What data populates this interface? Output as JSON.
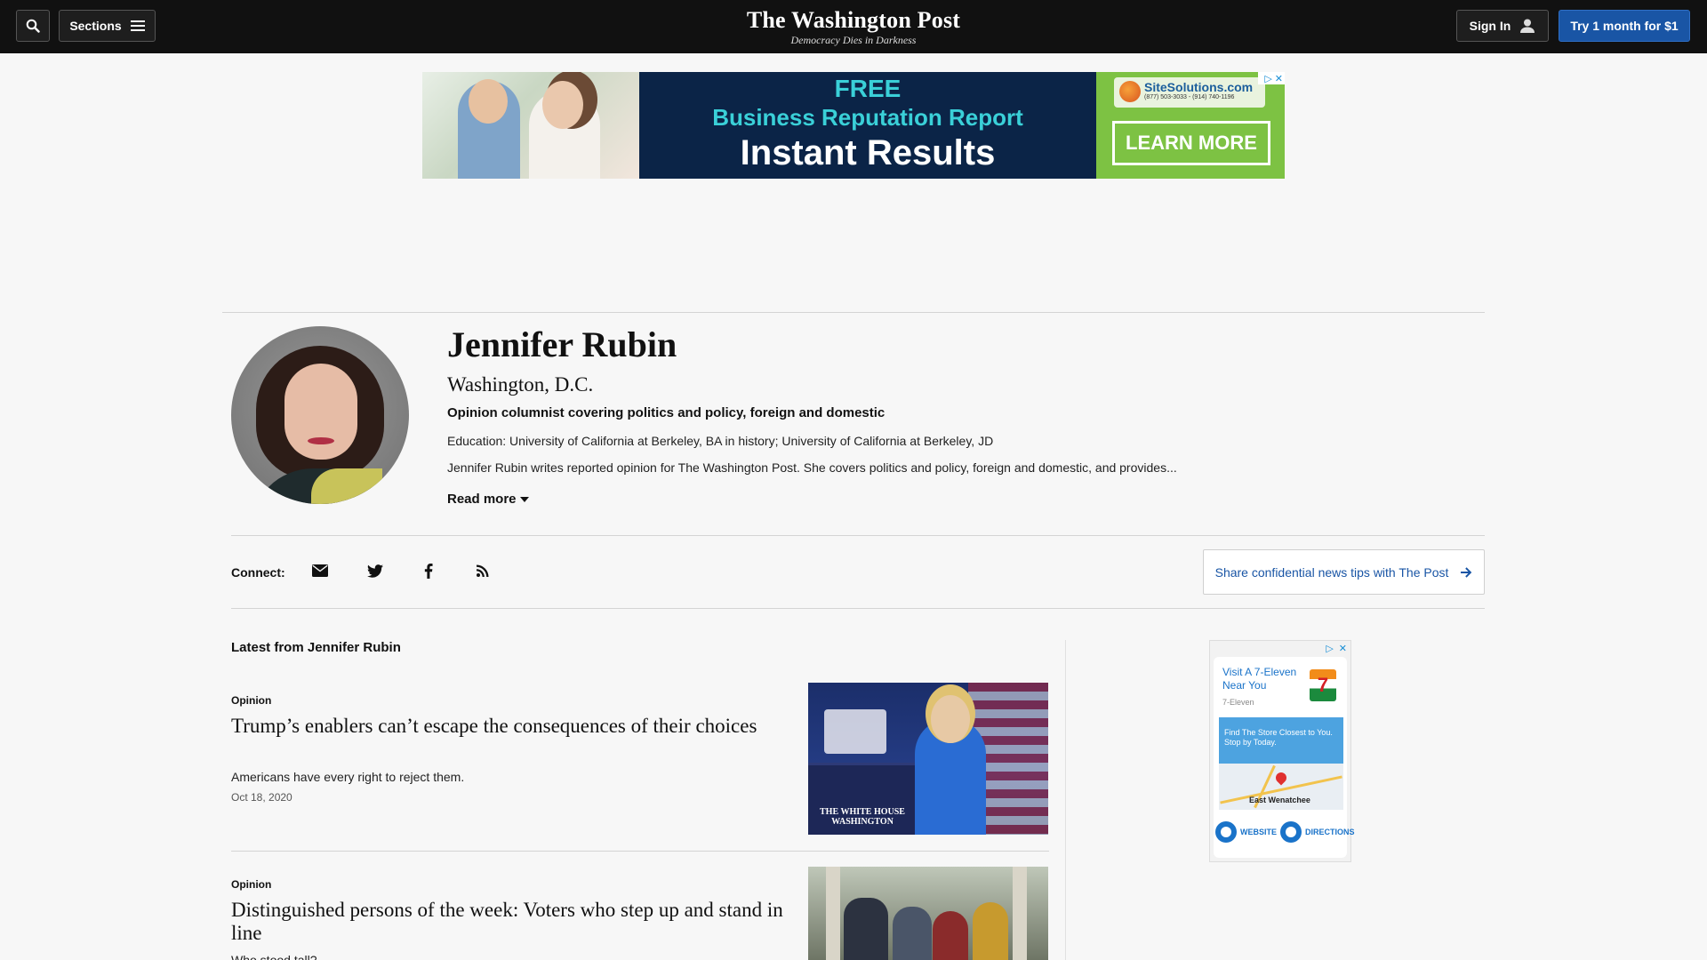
{
  "header": {
    "sections_label": "Sections",
    "logo": "The Washington Post",
    "tagline": "Democracy Dies in Darkness",
    "sign_in_label": "Sign In",
    "subscribe_label": "Try 1 month for $1"
  },
  "ad_banner": {
    "line1": "FREE",
    "line2": "Business Reputation Report",
    "line3": "Instant Results",
    "brand": "SiteSolutions.com",
    "phone": "(877) 503-3033 - (914) 740-1196",
    "cta": "LEARN MORE"
  },
  "profile": {
    "name": "Jennifer Rubin",
    "location": "Washington, D.C.",
    "role": "Opinion columnist covering politics and policy, foreign and domestic",
    "education": "Education: University of California at Berkeley, BA in history; University of California at Berkeley, JD",
    "bio": "Jennifer Rubin writes reported opinion for The Washington Post. She covers politics and policy, foreign and domestic, and provides...",
    "read_more": "Read more"
  },
  "connect": {
    "label": "Connect:",
    "icons": [
      "envelope-icon",
      "twitter-icon",
      "facebook-icon",
      "rss-icon"
    ],
    "tips_label": "Share confidential news tips with The Post"
  },
  "latest": {
    "title": "Latest from Jennifer Rubin",
    "articles": [
      {
        "kicker": "Opinion",
        "headline": "Trump’s enablers can’t escape the consequences of their choices",
        "blurb": "Americans have every right to reject them.",
        "date": "Oct 18, 2020",
        "thumb_label": "THE WHITE HOUSE WASHINGTON"
      },
      {
        "kicker": "Opinion",
        "headline": "Distinguished persons of the week: Voters who step up and stand in line",
        "blurb": "Who stood tall?"
      }
    ]
  },
  "side_ad": {
    "title": "Visit A 7-Eleven Near You",
    "brand": "7-Eleven",
    "logo_text": "7",
    "promo": "Find The Store Closest to You. Stop by Today.",
    "city": "East Wenatchee",
    "website_label": "WEBSITE",
    "directions_label": "DIRECTIONS"
  },
  "colors": {
    "topbar": "#111111",
    "accent": "#1955a5",
    "background": "#f7f7f7"
  }
}
